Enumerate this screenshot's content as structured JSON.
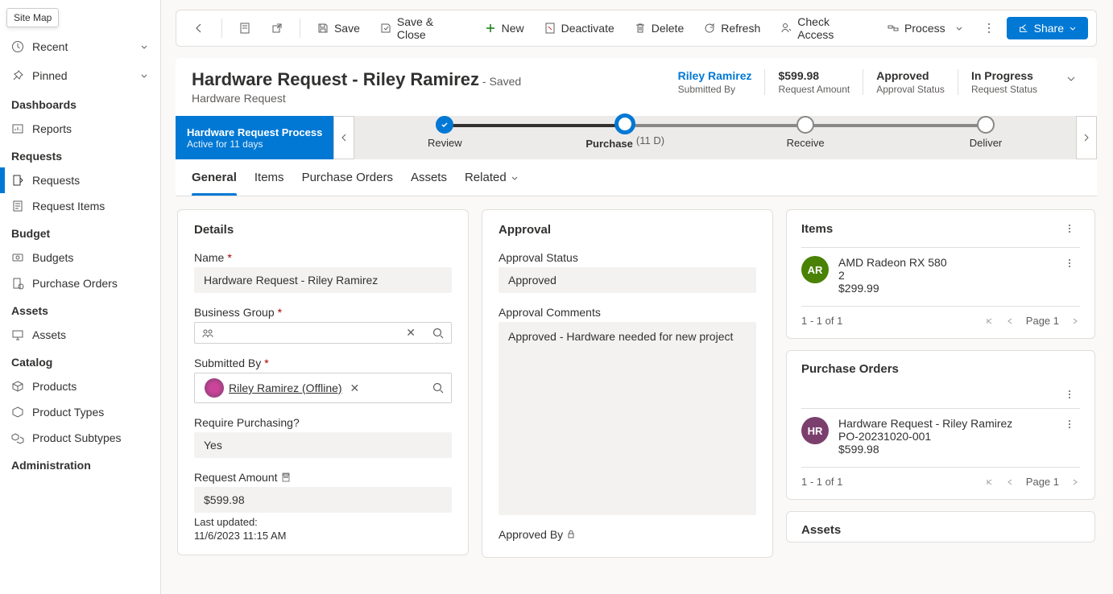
{
  "sitemap_tooltip": "Site Map",
  "sidebar": {
    "recent": "Recent",
    "pinned": "Pinned",
    "sections": [
      {
        "title": "Dashboards",
        "items": [
          {
            "label": "Reports"
          }
        ]
      },
      {
        "title": "Requests",
        "items": [
          {
            "label": "Requests",
            "active": true
          },
          {
            "label": "Request Items"
          }
        ]
      },
      {
        "title": "Budget",
        "items": [
          {
            "label": "Budgets"
          },
          {
            "label": "Purchase Orders"
          }
        ]
      },
      {
        "title": "Assets",
        "items": [
          {
            "label": "Assets"
          }
        ]
      },
      {
        "title": "Catalog",
        "items": [
          {
            "label": "Products"
          },
          {
            "label": "Product Types"
          },
          {
            "label": "Product Subtypes"
          }
        ]
      },
      {
        "title": "Administration",
        "items": []
      }
    ]
  },
  "commands": {
    "save": "Save",
    "save_close": "Save & Close",
    "new": "New",
    "deactivate": "Deactivate",
    "delete": "Delete",
    "refresh": "Refresh",
    "check_access": "Check Access",
    "process": "Process",
    "share": "Share"
  },
  "header": {
    "title": "Hardware Request - Riley Ramirez",
    "saved": "- Saved",
    "entity": "Hardware Request",
    "fields": [
      {
        "value": "Riley Ramirez",
        "label": "Submitted By",
        "link": true
      },
      {
        "value": "$599.98",
        "label": "Request Amount"
      },
      {
        "value": "Approved",
        "label": "Approval Status"
      },
      {
        "value": "In Progress",
        "label": "Request Status"
      }
    ]
  },
  "process": {
    "name": "Hardware Request Process",
    "duration": "Active for 11 days",
    "stages": [
      {
        "label": "Review",
        "state": "done"
      },
      {
        "label": "Purchase",
        "days": "(11 D)",
        "state": "current"
      },
      {
        "label": "Receive",
        "state": "future"
      },
      {
        "label": "Deliver",
        "state": "future"
      }
    ]
  },
  "tabs": [
    "General",
    "Items",
    "Purchase Orders",
    "Assets",
    "Related"
  ],
  "details": {
    "title": "Details",
    "name_label": "Name",
    "name_value": "Hardware Request - Riley Ramirez",
    "bg_label": "Business Group",
    "submitted_label": "Submitted By",
    "submitted_value": "Riley Ramirez (Offline)",
    "require_label": "Require Purchasing?",
    "require_value": "Yes",
    "amount_label": "Request Amount",
    "amount_value": "$599.98",
    "updated_label": "Last updated:",
    "updated_value": "11/6/2023 11:15 AM"
  },
  "approval": {
    "title": "Approval",
    "status_label": "Approval Status",
    "status_value": "Approved",
    "comments_label": "Approval Comments",
    "comments_value": "Approved - Hardware needed for new project",
    "approved_by_label": "Approved By"
  },
  "items_card": {
    "title": "Items",
    "item_title": "AMD Radeon RX 580",
    "item_qty": "2",
    "item_price": "$299.99",
    "avatar": "AR",
    "pager_count": "1 - 1 of 1",
    "pager_page": "Page 1"
  },
  "po_card": {
    "title": "Purchase Orders",
    "item_title": "Hardware Request - Riley Ramirez",
    "item_num": "PO-20231020-001",
    "item_price": "$599.98",
    "avatar": "HR",
    "pager_count": "1 - 1 of 1",
    "pager_page": "Page 1"
  },
  "assets_card": {
    "title": "Assets"
  }
}
